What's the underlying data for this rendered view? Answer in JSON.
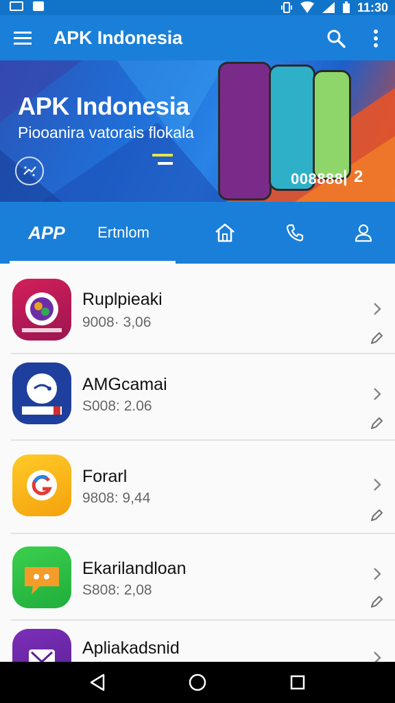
{
  "status_bar": {
    "time": "11:30"
  },
  "app_bar": {
    "title": "APK Indonesia"
  },
  "banner": {
    "title": "APK Indonesia",
    "subtitle": "Piooanira vatorais flokala",
    "counter": "008888",
    "separator": "|",
    "page": "2"
  },
  "tabs": {
    "app_label": "APP",
    "text_label": "Ertnlom"
  },
  "apps": [
    {
      "name": "Ruplpieaki",
      "meta": "9008· 3,06"
    },
    {
      "name": "AMGcamai",
      "meta": "S008: 2.06"
    },
    {
      "name": "Forarl",
      "meta": "9808: 9,44"
    },
    {
      "name": "Ekarilandloan",
      "meta": "S808: 2,08"
    },
    {
      "name": "Apliakadsnid",
      "meta": ""
    }
  ],
  "icons": {
    "menu": "hamburger-icon",
    "search": "search-icon",
    "more": "more-vert-icon",
    "home": "home-icon",
    "phone": "phone-icon",
    "user": "user-icon",
    "chevron": "chevron-right-icon",
    "edit": "pencil-icon",
    "back": "nav-back-icon",
    "home_nav": "nav-home-icon",
    "recents": "nav-recents-icon"
  },
  "colors": {
    "primary": "#1a7fd8",
    "status": "#1274c9",
    "text": "#111111",
    "meta": "#666666"
  }
}
